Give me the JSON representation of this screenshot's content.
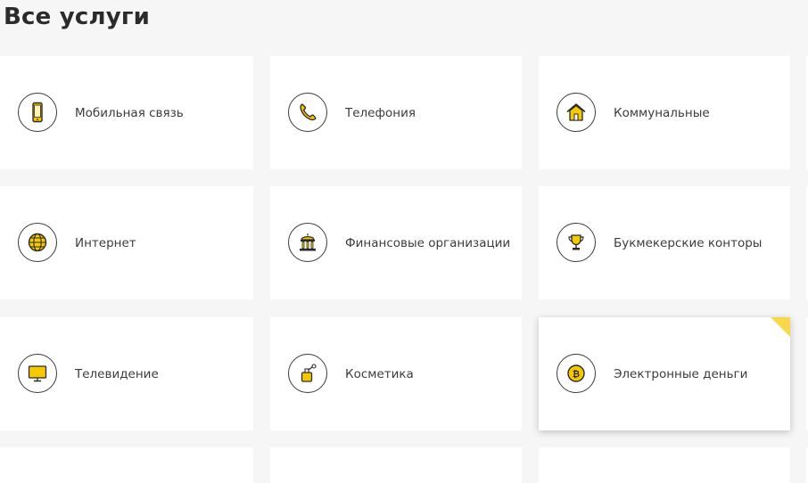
{
  "page": {
    "title": "Все услуги"
  },
  "colors": {
    "accent": "#f6c800",
    "background": "#f6f6f6",
    "tile": "#ffffff"
  },
  "services": [
    {
      "label": "Мобильная связь",
      "icon": "mobile-phone-icon"
    },
    {
      "label": "Телефония",
      "icon": "telephone-handset-icon"
    },
    {
      "label": "Коммунальные",
      "icon": "house-icon"
    },
    {
      "label": "Интернет",
      "icon": "globe-icon"
    },
    {
      "label": "Финансовые организации",
      "icon": "bank-building-icon"
    },
    {
      "label": "Букмекерские конторы",
      "icon": "trophy-icon"
    },
    {
      "label": "Телевидение",
      "icon": "tv-monitor-icon"
    },
    {
      "label": "Косметика",
      "icon": "perfume-bottle-icon"
    },
    {
      "label": "Электронные деньги",
      "icon": "bitcoin-coin-icon",
      "selected": true
    }
  ]
}
